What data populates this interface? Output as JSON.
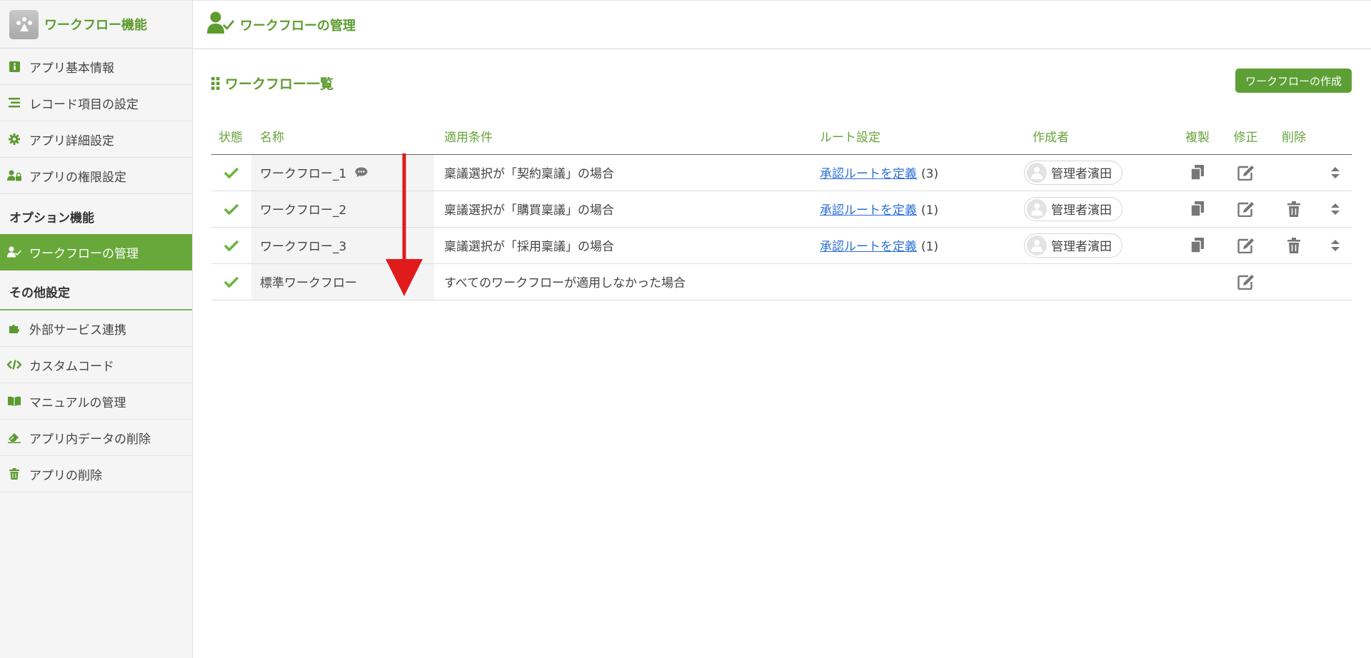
{
  "sidebar": {
    "brand_title": "ワークフロー機能",
    "items_top": [
      {
        "label": "アプリ基本情報",
        "icon": "info-icon"
      },
      {
        "label": "レコード項目の設定",
        "icon": "list-icon"
      },
      {
        "label": "アプリ詳細設定",
        "icon": "gear-icon"
      },
      {
        "label": "アプリの権限設定",
        "icon": "user-lock-icon"
      }
    ],
    "section_options": "オプション機能",
    "item_workflow": {
      "label": "ワークフローの管理",
      "icon": "user-check-icon"
    },
    "section_other": "その他設定",
    "items_other": [
      {
        "label": "外部サービス連携",
        "icon": "puzzle-icon"
      },
      {
        "label": "カスタムコード",
        "icon": "code-icon"
      },
      {
        "label": "マニュアルの管理",
        "icon": "book-icon"
      },
      {
        "label": "アプリ内データの削除",
        "icon": "eraser-icon"
      },
      {
        "label": "アプリの削除",
        "icon": "trash-icon"
      }
    ]
  },
  "header": {
    "title": "ワークフローの管理"
  },
  "main": {
    "list_title": "ワークフロー一覧",
    "create_button": "ワークフローの作成",
    "columns": {
      "state": "状態",
      "name": "名称",
      "condition": "適用条件",
      "route": "ルート設定",
      "author": "作成者",
      "copy": "複製",
      "edit": "修正",
      "delete": "削除"
    },
    "rows": [
      {
        "name": "ワークフロー_1",
        "condition": "稟議選択が「契約稟議」の場合",
        "route_link": "承認ルートを定義",
        "route_count": "(3)",
        "author": "管理者濱田"
      },
      {
        "name": "ワークフロー_2",
        "condition": "稟議選択が「購買稟議」の場合",
        "route_link": "承認ルートを定義",
        "route_count": "(1)",
        "author": "管理者濱田"
      },
      {
        "name": "ワークフロー_3",
        "condition": "稟議選択が「採用稟議」の場合",
        "route_link": "承認ルートを定義",
        "route_count": "(1)",
        "author": "管理者濱田"
      },
      {
        "name": "標準ワークフロー",
        "condition": "すべてのワークフローが適用しなかった場合"
      }
    ]
  },
  "colors": {
    "accent": "#5e9f35",
    "link": "#2b6fd6",
    "annotation_arrow": "#e01b1b"
  }
}
